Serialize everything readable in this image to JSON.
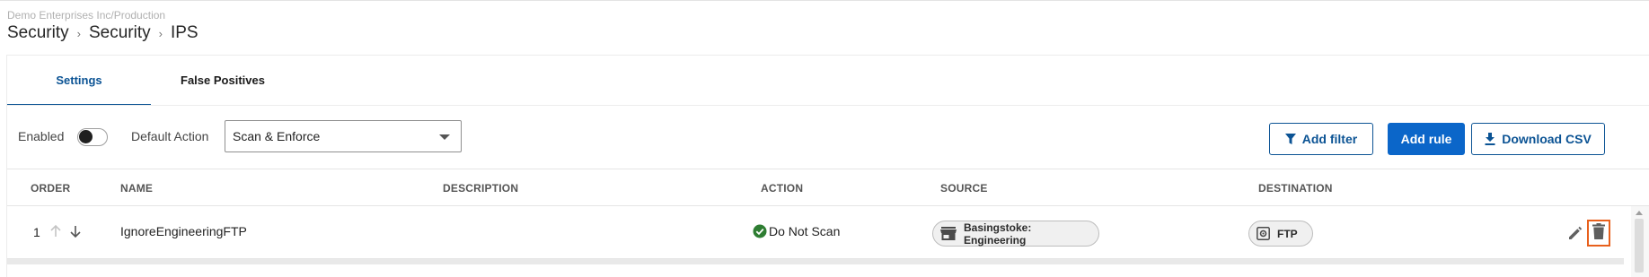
{
  "header": {
    "org_path": "Demo Enterprises Inc/Production",
    "breadcrumb": [
      "Security",
      "Security",
      "IPS"
    ],
    "separator": "›"
  },
  "tabs": [
    {
      "label": "Settings",
      "active": true
    },
    {
      "label": "False Positives",
      "active": false
    }
  ],
  "toolbar": {
    "enabled_label": "Enabled",
    "enabled_state": false,
    "default_action_label": "Default Action",
    "default_action_value": "Scan & Enforce",
    "add_filter_label": "Add filter",
    "add_rule_label": "Add rule",
    "download_csv_label": "Download CSV"
  },
  "table": {
    "columns": [
      "ORDER",
      "NAME",
      "DESCRIPTION",
      "ACTION",
      "SOURCE",
      "DESTINATION"
    ],
    "rows": [
      {
        "order": "1",
        "name": "IgnoreEngineeringFTP",
        "description": "",
        "action": "Do Not Scan",
        "source": "Basingstoke: Engineering",
        "destination": "FTP"
      }
    ]
  },
  "colors": {
    "primary": "#0b66c9",
    "accent_dark": "#0b5394",
    "success": "#2e7d32",
    "highlight": "#e8601c"
  },
  "icons": {
    "filter": "filter-icon",
    "download": "download-icon",
    "arrow_up": "arrow-up-icon",
    "arrow_down": "arrow-down-icon",
    "check": "check-circle-icon",
    "store": "store-icon",
    "service": "service-gear-icon",
    "edit": "pencil-icon",
    "delete": "trash-icon"
  }
}
